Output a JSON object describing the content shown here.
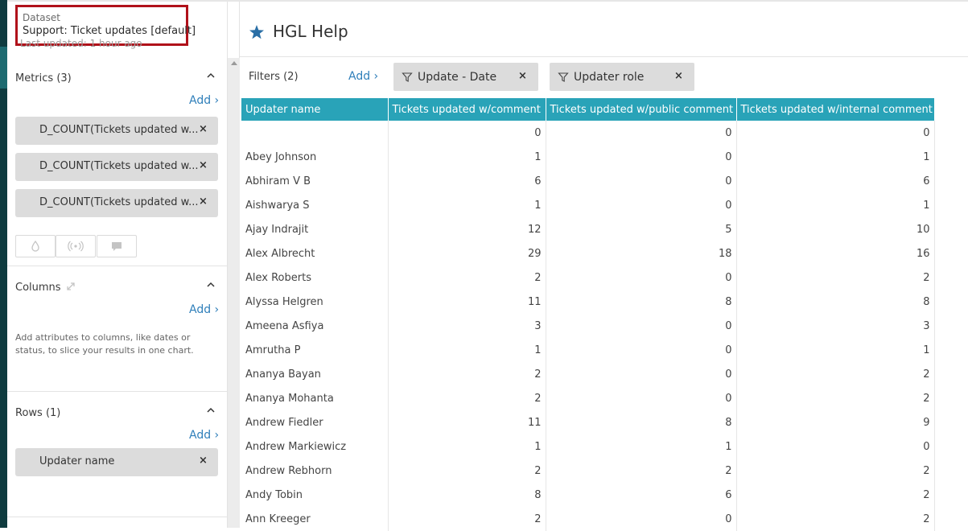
{
  "dataset": {
    "label": "Dataset",
    "name": "Support: Ticket updates [default]",
    "last_updated": "Last updated: 1 hour ago"
  },
  "app": {
    "title": "HGL Help"
  },
  "metrics": {
    "title": "Metrics (3)",
    "add_label": "Add ›",
    "items": [
      "D_COUNT(Tickets updated w...",
      "D_COUNT(Tickets updated w...",
      "D_COUNT(Tickets updated w..."
    ],
    "remove_glyph": "×"
  },
  "columns": {
    "title": "Columns",
    "add_label": "Add ›",
    "help": "Add attributes to columns, like dates or status, to slice your results in one chart."
  },
  "rows": {
    "title": "Rows (1)",
    "add_label": "Add ›",
    "items": [
      "Updater name"
    ]
  },
  "filters": {
    "label": "Filters (2)",
    "add_label": "Add ›",
    "items": [
      "Update - Date",
      "Updater role"
    ]
  },
  "table": {
    "headers": [
      "Updater name",
      "Tickets updated w/comment",
      "Tickets updated w/public comment",
      "Tickets updated w/internal comment"
    ],
    "rows": [
      [
        "",
        "0",
        "0",
        "0"
      ],
      [
        "Abey Johnson",
        "1",
        "0",
        "1"
      ],
      [
        "Abhiram V B",
        "6",
        "0",
        "6"
      ],
      [
        "Aishwarya S",
        "1",
        "0",
        "1"
      ],
      [
        "Ajay Indrajit",
        "12",
        "5",
        "10"
      ],
      [
        "Alex Albrecht",
        "29",
        "18",
        "16"
      ],
      [
        "Alex Roberts",
        "2",
        "0",
        "2"
      ],
      [
        "Alyssa Helgren",
        "11",
        "8",
        "8"
      ],
      [
        "Ameena Asfiya",
        "3",
        "0",
        "3"
      ],
      [
        "Amrutha P",
        "1",
        "0",
        "1"
      ],
      [
        "Ananya Bayan",
        "2",
        "0",
        "2"
      ],
      [
        "Ananya Mohanta",
        "2",
        "0",
        "2"
      ],
      [
        "Andrew Fiedler",
        "11",
        "8",
        "9"
      ],
      [
        "Andrew Markiewicz",
        "1",
        "1",
        "0"
      ],
      [
        "Andrew Rebhorn",
        "2",
        "2",
        "2"
      ],
      [
        "Andy Tobin",
        "8",
        "6",
        "2"
      ],
      [
        "Ann Kreeger",
        "2",
        "0",
        "2"
      ]
    ]
  },
  "colors": {
    "header_teal": "#29a3b8",
    "link_blue": "#2f7fba",
    "highlight_red": "#b0111a",
    "pill_gray": "#dcdcdc",
    "sidebar_dark": "#0f3b3f"
  }
}
